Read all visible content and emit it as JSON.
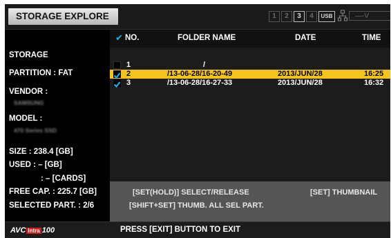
{
  "header": {
    "title": "STORAGE EXPLORE",
    "slots": [
      {
        "label": "1",
        "active": false
      },
      {
        "label": "2",
        "active": false
      },
      {
        "label": "3",
        "active": true
      },
      {
        "label": "4",
        "active": false
      },
      {
        "label": "USB",
        "active": true
      }
    ],
    "network_icon": "network-icon",
    "mode_text": "—-V"
  },
  "storage": {
    "heading": "STORAGE",
    "partition": "PARTITION : FAT",
    "vendor_label": "VENDOR :",
    "vendor_value": "SAMSUNG",
    "model_label": "MODEL :",
    "model_value": "470 Series SSD",
    "size": "SIZE : 238.4 [GB]",
    "used": "USED : – [GB]",
    "cards": ": – [CARDS]",
    "free_cap": "FREE CAP. : 225.7 [GB]",
    "selected_part": "SELECTED PART. : 2/6"
  },
  "table": {
    "columns": {
      "check": "✔",
      "no": "NO.",
      "folder": "FOLDER NAME",
      "date": "DATE",
      "time": "TIME"
    },
    "rows": [
      {
        "checked": false,
        "no": "1",
        "folder": "/",
        "date": "",
        "time": "",
        "selected": false
      },
      {
        "checked": true,
        "no": "2",
        "folder": "/13-06-28/16-20-49",
        "date": "2013/JUN/28",
        "time": "16:25",
        "selected": true
      },
      {
        "checked": true,
        "no": "3",
        "folder": "/13-06-28/16-27-33",
        "date": "2013/JUN/28",
        "time": "16:32",
        "selected": false
      }
    ]
  },
  "help": {
    "line1_left": "[SET(HOLD)] SELECT/RELEASE",
    "line1_right": "[SET] THUMBNAIL",
    "line2": "[SHIFT+SET] THUMB. ALL SEL PART."
  },
  "footer": {
    "logo_avc": "AVC",
    "logo_intra": "Intra",
    "logo_num": "100",
    "message": "PRESS [EXIT] BUTTON TO EXIT"
  },
  "colors": {
    "selection": "#f3c41c",
    "check": "#1fb3e8",
    "help_bg": "#555555",
    "list_bg": "#1c1c1c"
  }
}
